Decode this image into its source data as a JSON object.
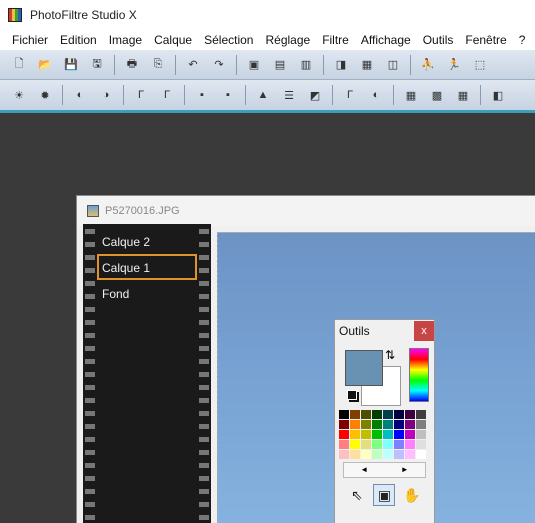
{
  "app": {
    "title": "PhotoFiltre Studio X"
  },
  "menu": [
    "Fichier",
    "Edition",
    "Image",
    "Calque",
    "Sélection",
    "Réglage",
    "Filtre",
    "Affichage",
    "Outils",
    "Fenêtre",
    "?"
  ],
  "toolbar1": [
    {
      "name": "new-file-icon",
      "glyph": "🗋"
    },
    {
      "name": "open-folder-icon",
      "glyph": "📂"
    },
    {
      "name": "save-icon",
      "glyph": "💾"
    },
    {
      "name": "save-as-icon",
      "glyph": "🖫"
    },
    {
      "sep": true
    },
    {
      "name": "print-icon",
      "glyph": "🖶"
    },
    {
      "name": "scan-icon",
      "glyph": "⎘"
    },
    {
      "sep": true
    },
    {
      "name": "undo-icon",
      "glyph": "↶"
    },
    {
      "name": "redo-icon",
      "glyph": "↷"
    },
    {
      "sep": true
    },
    {
      "name": "image-size-icon",
      "glyph": "▣"
    },
    {
      "name": "canvas-size-icon",
      "glyph": "▤"
    },
    {
      "name": "crop-icon",
      "glyph": "▥"
    },
    {
      "sep": true
    },
    {
      "name": "gradient-icon",
      "glyph": "◨"
    },
    {
      "name": "color-grid-icon",
      "glyph": "▦"
    },
    {
      "name": "transparency-icon",
      "glyph": "◫"
    },
    {
      "sep": true
    },
    {
      "name": "run-macro-icon",
      "glyph": "⛹"
    },
    {
      "name": "run-batch-icon",
      "glyph": "🏃"
    },
    {
      "name": "select-icon",
      "glyph": "⬚"
    }
  ],
  "toolbar2": [
    {
      "name": "brightness-minus-icon",
      "glyph": "☀"
    },
    {
      "name": "brightness-plus-icon",
      "glyph": "✹"
    },
    {
      "sep": true
    },
    {
      "name": "contrast-minus-icon",
      "glyph": "◐"
    },
    {
      "name": "contrast-plus-icon",
      "glyph": "◑"
    },
    {
      "sep": true
    },
    {
      "name": "gamma-minus-icon",
      "glyph": "Γ"
    },
    {
      "name": "gamma-plus-icon",
      "glyph": "Γ"
    },
    {
      "sep": true
    },
    {
      "name": "saturation-minus-icon",
      "glyph": "▪"
    },
    {
      "name": "saturation-plus-icon",
      "glyph": "▪"
    },
    {
      "sep": true
    },
    {
      "name": "histogram-icon",
      "glyph": "▲"
    },
    {
      "name": "levels-icon",
      "glyph": "☰"
    },
    {
      "name": "invert-icon",
      "glyph": "◩"
    },
    {
      "sep": true
    },
    {
      "name": "auto-gamma-icon",
      "glyph": "Γ"
    },
    {
      "name": "auto-contrast-icon",
      "glyph": "◐"
    },
    {
      "sep": true
    },
    {
      "name": "filter-grid-1-icon",
      "glyph": "▦"
    },
    {
      "name": "filter-grid-2-icon",
      "glyph": "▩"
    },
    {
      "name": "filter-grid-3-icon",
      "glyph": "▦"
    },
    {
      "sep": true
    },
    {
      "name": "panel-toggle-icon",
      "glyph": "◧"
    }
  ],
  "document": {
    "title": "P5270016.JPG"
  },
  "layers": [
    {
      "label": "Calque 2",
      "active": false
    },
    {
      "label": "Calque 1",
      "active": true
    },
    {
      "label": "Fond",
      "active": false
    }
  ],
  "tools_panel": {
    "title": "Outils",
    "close": "x",
    "foreground_color": "#6891b2",
    "background_color": "#ffffff",
    "palette": [
      "#000000",
      "#7f3f00",
      "#4f4f00",
      "#003f00",
      "#003f4f",
      "#00003f",
      "#3f003f",
      "#3f3f3f",
      "#7f0000",
      "#ff7f00",
      "#7f7f00",
      "#007f00",
      "#007f7f",
      "#00007f",
      "#7f007f",
      "#7f7f7f",
      "#ff0000",
      "#ffbf00",
      "#bfbf00",
      "#00bf00",
      "#00bfbf",
      "#0000ff",
      "#bf00bf",
      "#bfbfbf",
      "#ff7f7f",
      "#ffff00",
      "#dfdf7f",
      "#7fff7f",
      "#7fffff",
      "#7f7fff",
      "#ff7fff",
      "#dfdfdf",
      "#ffbfbf",
      "#ffdf9f",
      "#ffffbf",
      "#bfffbf",
      "#bfffff",
      "#bfbfff",
      "#ffbfff",
      "#ffffff"
    ],
    "nav_prev": "◄",
    "nav_next": "►",
    "tools": [
      {
        "name": "pointer-tool-icon",
        "glyph": "⇖",
        "active": false
      },
      {
        "name": "move-layer-tool-icon",
        "glyph": "▣",
        "active": true
      },
      {
        "name": "hand-tool-icon",
        "glyph": "✋",
        "active": false
      }
    ]
  }
}
